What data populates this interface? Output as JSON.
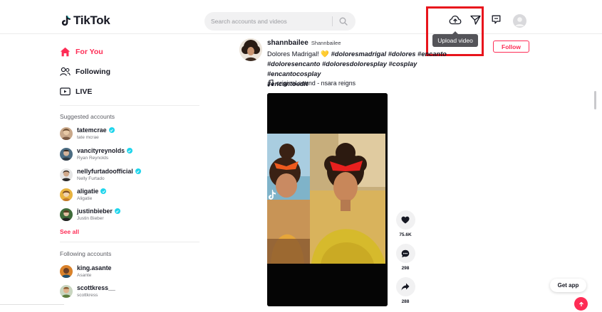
{
  "header": {
    "logo_text": "TikTok",
    "search_placeholder": "Search accounts and videos",
    "upload_tooltip": "Upload video"
  },
  "sidebar": {
    "nav": [
      {
        "label": "For You",
        "icon": "home-icon",
        "active": true
      },
      {
        "label": "Following",
        "icon": "users-icon",
        "active": false
      },
      {
        "label": "LIVE",
        "icon": "live-icon",
        "active": false
      }
    ],
    "suggested_title": "Suggested accounts",
    "suggested": [
      {
        "username": "tatemcrae",
        "name": "tate mcrae",
        "verified": true
      },
      {
        "username": "vancityreynolds",
        "name": "Ryan Reynolds",
        "verified": true
      },
      {
        "username": "nellyfurtadoofficial",
        "name": "Nelly Furtado",
        "verified": true
      },
      {
        "username": "aligatie",
        "name": "Aligatie",
        "verified": true
      },
      {
        "username": "justinbieber",
        "name": "Justin Bieber",
        "verified": true
      }
    ],
    "see_all": "See all",
    "following_title": "Following accounts",
    "following": [
      {
        "username": "king.asante",
        "name": "Asante"
      },
      {
        "username": "scottkress__",
        "name": "scottkress"
      }
    ]
  },
  "post": {
    "username": "shannbailee",
    "nickname": "Shannbailee",
    "caption_text": "Dolores Madrigal! 💛 ",
    "hashtags_line1": "#doloresmadrigal #dolores #encanto",
    "hashtags_line2": "#doloresencanto #doloresdoloresplay #cosplay #encantocosplay",
    "hashtags_line3": "#encantoedit",
    "music": "original sound - nsara reigns",
    "follow_label": "Follow",
    "likes": "75.6K",
    "comments": "298",
    "shares": "288"
  },
  "get_app": "Get app",
  "colors": {
    "brand": "#fe2c55",
    "highlight": "#e8141c",
    "verified": "#20d5ec"
  }
}
